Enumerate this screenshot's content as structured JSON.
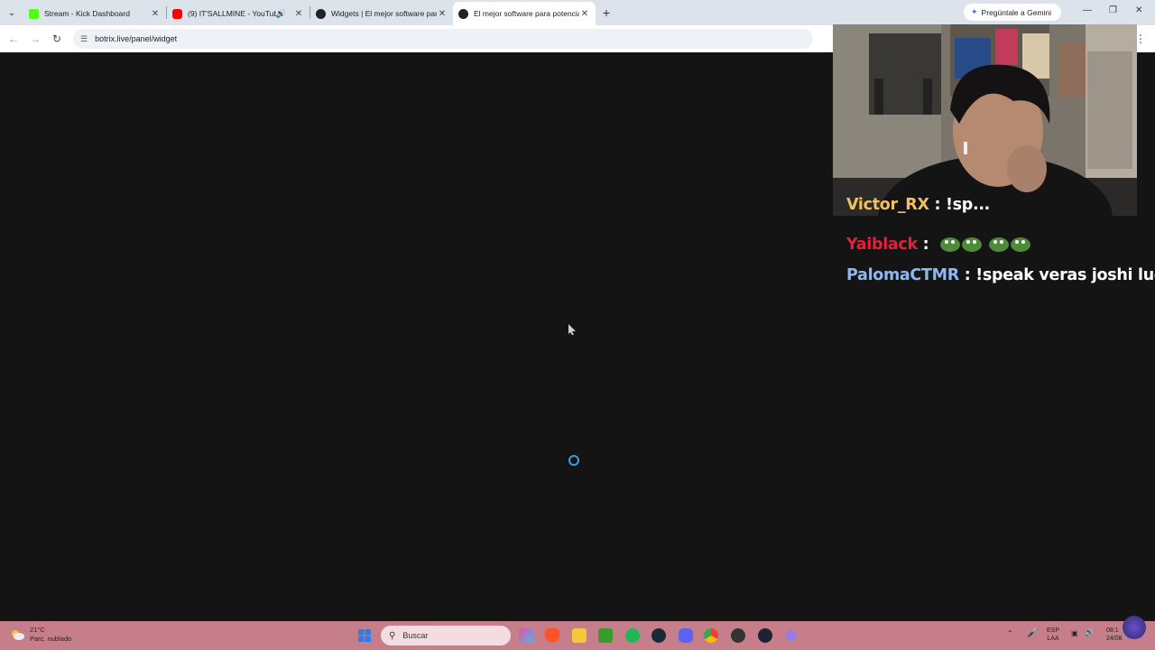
{
  "browser": {
    "tabs": [
      {
        "title": "Stream - Kick Dashboard",
        "favicon_color": "#53fc18",
        "active": false
      },
      {
        "title": "(9) IT'SALLMINE - YouTube",
        "favicon_color": "#ff0000",
        "active": false,
        "audio": true
      },
      {
        "title": "Widgets | El mejor software para",
        "favicon_color": "#222222",
        "active": false
      },
      {
        "title": "El mejor software para potencia",
        "favicon_color": "#222222",
        "active": true
      }
    ],
    "close_glyph": "✕",
    "new_tab_glyph": "+",
    "gemini_label": "Pregúntale a Gemini",
    "url": "botrix.live/panel/widget"
  },
  "overlay": {
    "chat": [
      {
        "user": "Victor_RX",
        "user_color": "#f0c060",
        "message": ": !sp..."
      },
      {
        "user": "Yaiblack",
        "user_color": "#e2203a",
        "message": ":",
        "emote": "pepe-emotes"
      },
      {
        "user": "PalomaCTMR",
        "user_color": "#8fb8f0",
        "message": ": !speak veras joshi luck?"
      }
    ]
  },
  "taskbar": {
    "weather_temp": "21°C",
    "weather_desc": "Parc. nublado",
    "search_placeholder": "Buscar",
    "lang_top": "ESP",
    "lang_bottom": "LAA",
    "time": "08:1",
    "date": "24/08"
  },
  "colors": {
    "page_bg": "#141414",
    "taskbar_bg": "#c67f8a",
    "spinner": "#3aa0e6"
  }
}
